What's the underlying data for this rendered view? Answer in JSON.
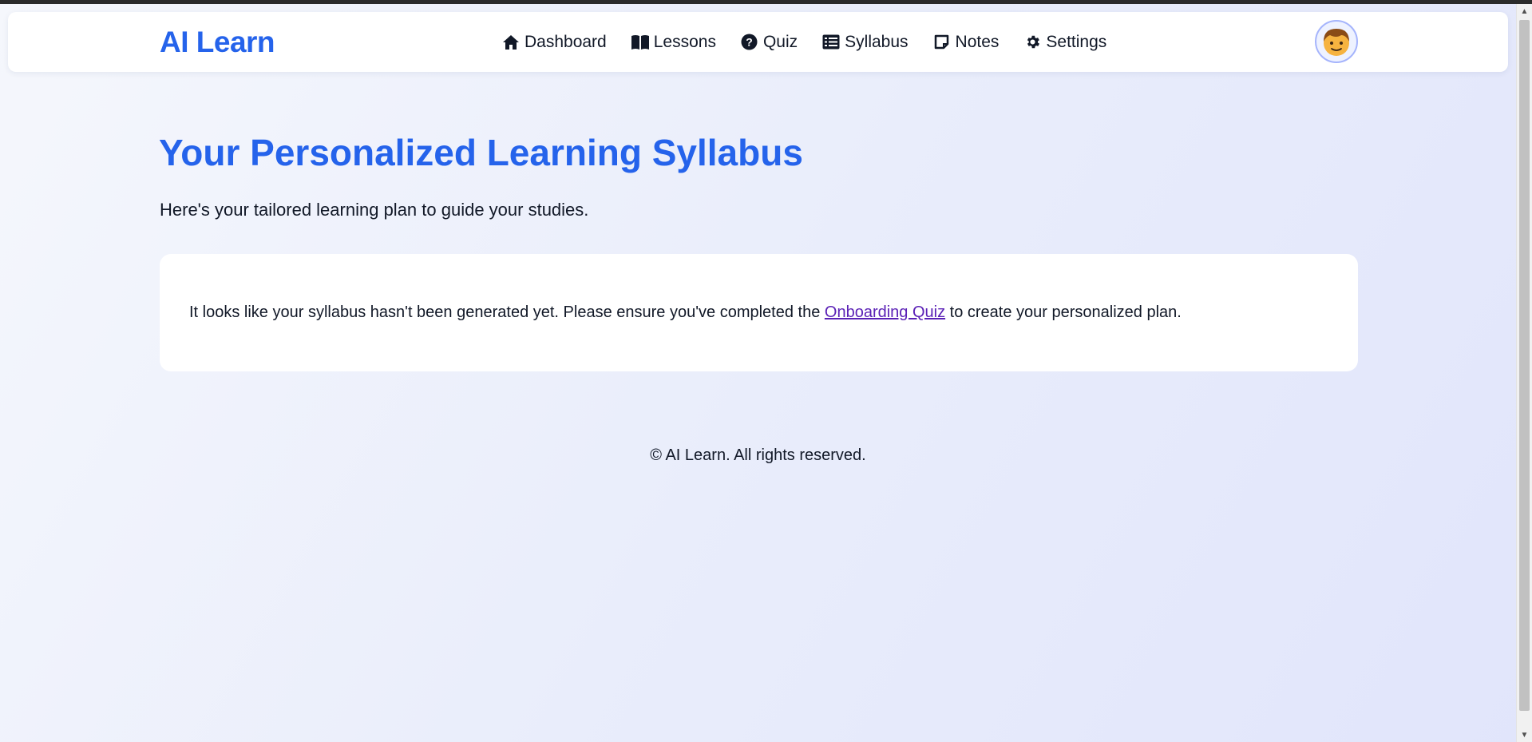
{
  "navbar": {
    "brand": "AI Learn",
    "links": [
      {
        "label": "Dashboard",
        "icon": "home-icon"
      },
      {
        "label": "Lessons",
        "icon": "book-icon"
      },
      {
        "label": "Quiz",
        "icon": "question-circle-icon"
      },
      {
        "label": "Syllabus",
        "icon": "list-icon"
      },
      {
        "label": "Notes",
        "icon": "note-icon"
      },
      {
        "label": "Settings",
        "icon": "gear-icon"
      }
    ],
    "avatar_icon": "boy-face-avatar"
  },
  "main": {
    "title": "Your Personalized Learning Syllabus",
    "subtitle": "Here's your tailored learning plan to guide your studies.",
    "notice": {
      "text_before": "It looks like your syllabus hasn't been generated yet. Please ensure you've completed the ",
      "link_label": "Onboarding Quiz",
      "text_after": " to create your personalized plan."
    }
  },
  "footer": {
    "text": "© AI Learn. All rights reserved."
  },
  "colors": {
    "accent": "#2563eb",
    "link_visited": "#5b21b6",
    "text": "#111827",
    "card": "#ffffff"
  }
}
